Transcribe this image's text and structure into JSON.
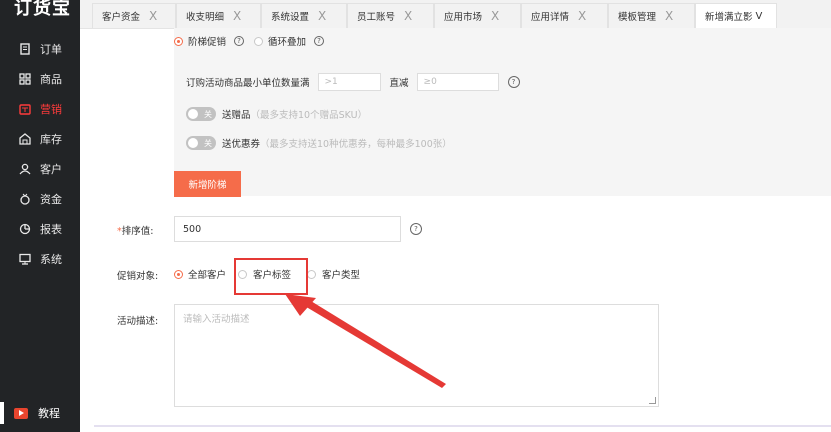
{
  "app": {
    "logo": "订货宝"
  },
  "sidebar": {
    "items": [
      {
        "label": "订单",
        "icon": "order-icon",
        "active": false
      },
      {
        "label": "商品",
        "icon": "grid-icon",
        "active": false
      },
      {
        "label": "营销",
        "icon": "marketing-icon",
        "active": true
      },
      {
        "label": "库存",
        "icon": "warehouse-icon",
        "active": false
      },
      {
        "label": "客户",
        "icon": "user-icon",
        "active": false
      },
      {
        "label": "资金",
        "icon": "money-icon",
        "active": false
      },
      {
        "label": "报表",
        "icon": "chart-icon",
        "active": false
      },
      {
        "label": "系统",
        "icon": "monitor-icon",
        "active": false
      }
    ],
    "help": {
      "label": "教程",
      "icon": "video-icon"
    }
  },
  "tabs": [
    {
      "label": "客户资金",
      "close": "X"
    },
    {
      "label": "收支明细",
      "close": "X"
    },
    {
      "label": "系统设置",
      "close": "X"
    },
    {
      "label": "员工账号",
      "close": "X"
    },
    {
      "label": "应用市场",
      "close": "X"
    },
    {
      "label": "应用详情",
      "close": "X"
    },
    {
      "label": "模板管理",
      "close": "X"
    },
    {
      "label": "新增满立影",
      "close": "V",
      "active": true
    }
  ],
  "promo": {
    "mode_options": [
      {
        "label": "阶梯促销",
        "selected": true
      },
      {
        "label": "循环叠加",
        "selected": false
      }
    ],
    "min_qty_label": "订购活动商品最小单位数量满",
    "min_qty_placeholder": ">1",
    "discount_label": "直减",
    "discount_placeholder": "≥0",
    "gift_toggle": {
      "state": "关",
      "label": "送赠品",
      "hint": "（最多支持10个赠品SKU）"
    },
    "coupon_toggle": {
      "state": "关",
      "label": "送优惠券",
      "hint": "（最多支持送10种优惠券，每种最多100张）"
    },
    "add_tier_button": "新增阶梯"
  },
  "form": {
    "sort_label": "排序值:",
    "required_mark": "*",
    "sort_value": "500",
    "target_label": "促销对象:",
    "target_options": [
      {
        "label": "全部客户",
        "selected": true
      },
      {
        "label": "客户标签",
        "selected": false
      },
      {
        "label": "客户类型",
        "selected": false
      }
    ],
    "desc_label": "活动描述:",
    "desc_placeholder": "请输入活动描述"
  },
  "colors": {
    "accent": "#f56c4a",
    "sidebar_bg": "#222426",
    "highlight": "#e53935"
  }
}
